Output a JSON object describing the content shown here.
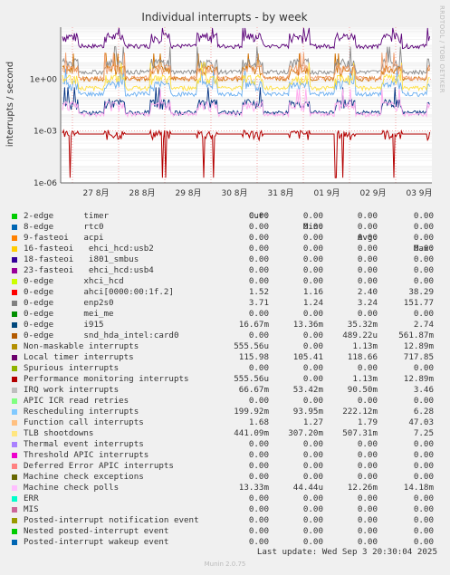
{
  "title": "Individual interrupts - by week",
  "side_label": "RRDTOOL / TOBI OETIKER",
  "chart_data": {
    "type": "line",
    "title": "Individual interrupts - by week",
    "ylabel": "interrupts / second",
    "yscale": "log",
    "ylim": [
      1e-06,
      1000
    ],
    "y_ticks": [
      {
        "value": 1e-06,
        "label": "1e-06"
      },
      {
        "value": 0.001,
        "label": "1e-03"
      },
      {
        "value": 1,
        "label": "1e+00"
      }
    ],
    "x_ticks": [
      "27 8月",
      "28 8月",
      "29 8月",
      "30 8月",
      "31 8月",
      "01 9月",
      "02 9月",
      "03 9月"
    ],
    "grid": true,
    "series": [
      {
        "name": "Local timer interrupts",
        "color": "#5a0078",
        "value": 115.98
      },
      {
        "name": "Performance monitoring interrupts",
        "color": "#b50000",
        "value": 0.0005556
      },
      {
        "name": "ahci[0000:00:1f.2]",
        "color": "#d07000",
        "value": 1.52
      },
      {
        "name": "enp2s0",
        "color": "#888888",
        "value": 3.71
      },
      {
        "name": "i915",
        "color": "#003080",
        "value": 0.01667
      },
      {
        "name": "Rescheduling interrupts",
        "color": "#6aaef0",
        "value": 0.19992
      },
      {
        "name": "TLB shootdowns",
        "color": "#ffe040",
        "value": 0.44109
      },
      {
        "name": "Function call interrupts",
        "color": "#f0a070",
        "value": 1.68
      },
      {
        "name": "Machine check polls",
        "color": "#ffaaee",
        "value": 0.01333
      }
    ]
  },
  "legend_header": {
    "cur": "Cur:",
    "min": "Min:",
    "avg": "Avg:",
    "max": "Max:"
  },
  "legend": [
    {
      "name": "2-edge      timer",
      "color": "#00cc00",
      "cur": "0.00",
      "min": "0.00",
      "avg": "0.00",
      "max": "0.00"
    },
    {
      "name": "8-edge      rtc0",
      "color": "#0066b3",
      "cur": "0.00",
      "min": "0.00",
      "avg": "0.00",
      "max": "0.00"
    },
    {
      "name": "9-fasteoi   acpi",
      "color": "#ff8000",
      "cur": "0.00",
      "min": "0.00",
      "avg": "0.00",
      "max": "0.00"
    },
    {
      "name": "16-fasteoi   ehci_hcd:usb2",
      "color": "#ffcc00",
      "cur": "0.00",
      "min": "0.00",
      "avg": "0.00",
      "max": "0.00"
    },
    {
      "name": "18-fasteoi   i801_smbus",
      "color": "#330099",
      "cur": "0.00",
      "min": "0.00",
      "avg": "0.00",
      "max": "0.00"
    },
    {
      "name": "23-fasteoi   ehci_hcd:usb4",
      "color": "#990099",
      "cur": "0.00",
      "min": "0.00",
      "avg": "0.00",
      "max": "0.00"
    },
    {
      "name": "0-edge      xhci_hcd",
      "color": "#ccff00",
      "cur": "0.00",
      "min": "0.00",
      "avg": "0.00",
      "max": "0.00"
    },
    {
      "name": "0-edge      ahci[0000:00:1f.2]",
      "color": "#ff0000",
      "cur": "1.52",
      "min": "1.16",
      "avg": "2.40",
      "max": "38.29"
    },
    {
      "name": "0-edge      enp2s0",
      "color": "#808080",
      "cur": "3.71",
      "min": "1.24",
      "avg": "3.24",
      "max": "151.77"
    },
    {
      "name": "0-edge      mei_me",
      "color": "#008f00",
      "cur": "0.00",
      "min": "0.00",
      "avg": "0.00",
      "max": "0.00"
    },
    {
      "name": "0-edge      i915",
      "color": "#00487d",
      "cur": "16.67m",
      "min": "13.36m",
      "avg": "35.32m",
      "max": "2.74"
    },
    {
      "name": "0-edge      snd_hda_intel:card0",
      "color": "#b35a00",
      "cur": "0.00",
      "min": "0.00",
      "avg": "489.22u",
      "max": "561.87m"
    },
    {
      "name": "Non-maskable interrupts",
      "color": "#b38f00",
      "cur": "555.56u",
      "min": "0.00",
      "avg": "1.13m",
      "max": "12.89m"
    },
    {
      "name": "Local timer interrupts",
      "color": "#6b006b",
      "cur": "115.98",
      "min": "105.41",
      "avg": "118.66",
      "max": "717.85"
    },
    {
      "name": "Spurious interrupts",
      "color": "#8fb300",
      "cur": "0.00",
      "min": "0.00",
      "avg": "0.00",
      "max": "0.00"
    },
    {
      "name": "Performance monitoring interrupts",
      "color": "#b30000",
      "cur": "555.56u",
      "min": "0.00",
      "avg": "1.13m",
      "max": "12.89m"
    },
    {
      "name": "IRQ work interrupts",
      "color": "#bebebe",
      "cur": "66.67m",
      "min": "53.42m",
      "avg": "90.50m",
      "max": "3.46"
    },
    {
      "name": "APIC ICR read retries",
      "color": "#80ff80",
      "cur": "0.00",
      "min": "0.00",
      "avg": "0.00",
      "max": "0.00"
    },
    {
      "name": "Rescheduling interrupts",
      "color": "#80c9ff",
      "cur": "199.92m",
      "min": "93.95m",
      "avg": "222.12m",
      "max": "6.28"
    },
    {
      "name": "Function call interrupts",
      "color": "#ffc080",
      "cur": "1.68",
      "min": "1.27",
      "avg": "1.79",
      "max": "47.03"
    },
    {
      "name": "TLB shootdowns",
      "color": "#ffe680",
      "cur": "441.09m",
      "min": "307.20m",
      "avg": "507.31m",
      "max": "7.25"
    },
    {
      "name": "Thermal event interrupts",
      "color": "#aa80ff",
      "cur": "0.00",
      "min": "0.00",
      "avg": "0.00",
      "max": "0.00"
    },
    {
      "name": "Threshold APIC interrupts",
      "color": "#ee00cc",
      "cur": "0.00",
      "min": "0.00",
      "avg": "0.00",
      "max": "0.00"
    },
    {
      "name": "Deferred Error APIC interrupts",
      "color": "#ff8080",
      "cur": "0.00",
      "min": "0.00",
      "avg": "0.00",
      "max": "0.00"
    },
    {
      "name": "Machine check exceptions",
      "color": "#666600",
      "cur": "0.00",
      "min": "0.00",
      "avg": "0.00",
      "max": "0.00"
    },
    {
      "name": "Machine check polls",
      "color": "#ffbfff",
      "cur": "13.33m",
      "min": "44.44u",
      "avg": "12.26m",
      "max": "14.18m"
    },
    {
      "name": "ERR",
      "color": "#00ffcc",
      "cur": "0.00",
      "min": "0.00",
      "avg": "0.00",
      "max": "0.00"
    },
    {
      "name": "MIS",
      "color": "#cc6699",
      "cur": "0.00",
      "min": "0.00",
      "avg": "0.00",
      "max": "0.00"
    },
    {
      "name": "Posted-interrupt notification event",
      "color": "#999900",
      "cur": "0.00",
      "min": "0.00",
      "avg": "0.00",
      "max": "0.00"
    },
    {
      "name": "Nested posted-interrupt event",
      "color": "#00cc00",
      "cur": "0.00",
      "min": "0.00",
      "avg": "0.00",
      "max": "0.00"
    },
    {
      "name": "Posted-interrupt wakeup event",
      "color": "#0066b3",
      "cur": "0.00",
      "min": "0.00",
      "avg": "0.00",
      "max": "0.00"
    }
  ],
  "last_update": "Last update: Wed Sep  3 20:30:04 2025",
  "munin_version": "Munin 2.0.75"
}
